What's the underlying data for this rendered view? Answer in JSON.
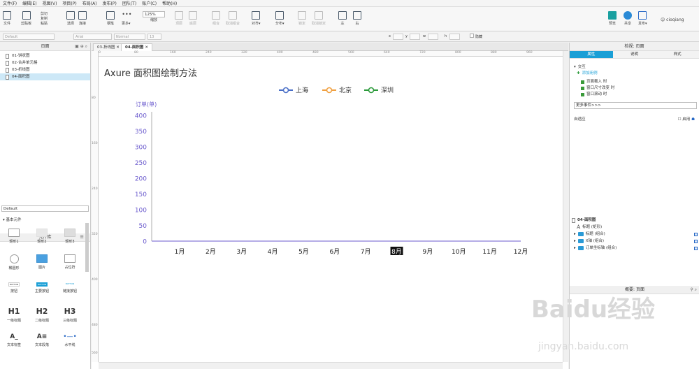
{
  "menu": [
    "文件(F)",
    "编辑(E)",
    "视图(V)",
    "项目(P)",
    "布局(A)",
    "发布(P)",
    "团队(T)",
    "账户(C)",
    "帮助(H)"
  ],
  "toolbar": {
    "file": "文件",
    "clipboard": "剪贴板",
    "cut": "剪切",
    "copy": "复制",
    "paste": "粘贴",
    "select": "选择",
    "connect": "连接",
    "pen": "钢笔",
    "more": "更多▾",
    "zoom": "125%",
    "zoom_label": "缩放",
    "top": "顶层",
    "bottom": "底层",
    "group": "组合",
    "ungroup": "取消组合",
    "align": "对齐▾",
    "distribute": "分布▾",
    "lock": "锁定",
    "unlock": "取消锁定",
    "left": "左",
    "right": "右",
    "preview": "预览",
    "share": "共享",
    "publish": "发布▾",
    "user": "cioqiang"
  },
  "format": {
    "style": "Default",
    "font": "Arial",
    "weight": "Normal",
    "size": "13",
    "x": "x",
    "y": "y",
    "w": "w",
    "h": "h",
    "hidden": "隐藏"
  },
  "pages": {
    "title": "页面",
    "items": [
      "01-饼状图",
      "02-合并单元格",
      "03-折线图",
      "04-面积图"
    ]
  },
  "library": {
    "title": "元件库",
    "select": "Default",
    "section": "基本元件",
    "widgets": [
      "矩形1",
      "矩形2",
      "矩形3",
      "椭圆形",
      "图片",
      "占位符",
      "按钮",
      "主要按钮",
      "链接按钮",
      "一级标题",
      "二级标题",
      "三级标题",
      "文本标签",
      "文本段落",
      "水平线"
    ],
    "btn_labels": [
      "BUTTON",
      "BUTTON",
      "BUTTON"
    ],
    "headings": [
      "H1",
      "H2",
      "H3"
    ]
  },
  "tabs": [
    "03-折线图",
    "04-面积图"
  ],
  "hruler": [
    "0",
    "80",
    "160",
    "240",
    "320",
    "400",
    "480",
    "560",
    "640",
    "720",
    "800",
    "880",
    "960"
  ],
  "vruler": [
    "80",
    "160",
    "240",
    "320",
    "400",
    "480",
    "560"
  ],
  "canvas": {
    "title": "Axure 面积图绘制方法"
  },
  "chart_data": {
    "type": "line",
    "ylabel": "订单(单)",
    "ylim": [
      0,
      400
    ],
    "yticks": [
      "400",
      "350",
      "300",
      "250",
      "200",
      "150",
      "100",
      "50",
      "0"
    ],
    "categories": [
      "1月",
      "2月",
      "3月",
      "4月",
      "5月",
      "6月",
      "7月",
      "8月",
      "9月",
      "10月",
      "11月",
      "12月"
    ],
    "highlight": "8月",
    "series": [
      {
        "name": "上海",
        "color": "#4a6fc7",
        "values": []
      },
      {
        "name": "北京",
        "color": "#f0a040",
        "values": []
      },
      {
        "name": "深圳",
        "color": "#2a9a3a",
        "values": []
      }
    ],
    "legend": "top-center"
  },
  "right": {
    "header": "检视: 页面",
    "tabs": [
      "属性",
      "说明",
      "样式"
    ],
    "section": "交互",
    "add_case": "添加用例",
    "events": [
      "页面载入 时",
      "窗口尺寸改变 时",
      "窗口滚动 时"
    ],
    "more_events": "更多事件>>>",
    "adaptive": "自适应",
    "enable": "启用",
    "outline_title": "概要: 页面",
    "outline_page": "04-面积图",
    "outline_items": [
      "标题 (矩形)",
      "标题 (组合)",
      "X轴 (组合)",
      "订单坐标轴 (组合)"
    ]
  },
  "watermark": "Baidu经验",
  "watermark_url": "jingyan.baidu.com"
}
